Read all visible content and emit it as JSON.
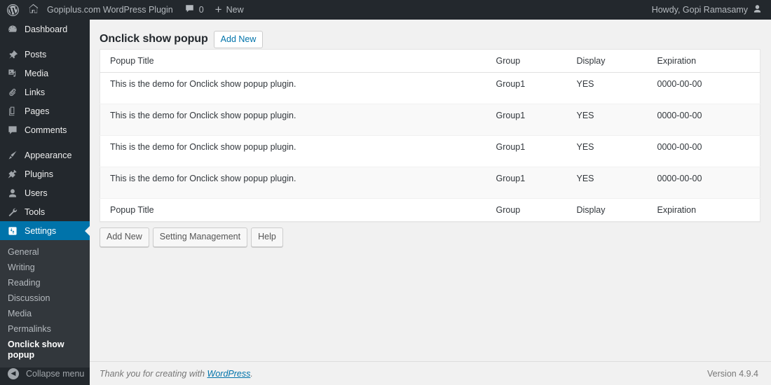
{
  "adminbar": {
    "logo_icon": "wordpress-logo-icon",
    "home_icon": "home-icon",
    "site_name": "Gopiplus.com WordPress Plugin",
    "comments_icon": "comment-bubble-icon",
    "comments_count": "0",
    "new_icon": "plus-icon",
    "new_label": "New",
    "howdy": "Howdy, Gopi Ramasamy",
    "avatar_icon": "user-avatar-icon"
  },
  "sidebar": {
    "items": [
      {
        "label": "Dashboard",
        "icon": "dashboard-icon",
        "current": false
      },
      {
        "label": "Posts",
        "icon": "pin-icon",
        "current": false
      },
      {
        "label": "Media",
        "icon": "media-icon",
        "current": false
      },
      {
        "label": "Links",
        "icon": "link-icon",
        "current": false
      },
      {
        "label": "Pages",
        "icon": "pages-icon",
        "current": false
      },
      {
        "label": "Comments",
        "icon": "comment-icon",
        "current": false
      },
      {
        "label": "Appearance",
        "icon": "appearance-brush-icon",
        "current": false
      },
      {
        "label": "Plugins",
        "icon": "plugin-icon",
        "current": false
      },
      {
        "label": "Users",
        "icon": "users-icon",
        "current": false
      },
      {
        "label": "Tools",
        "icon": "tools-wrench-icon",
        "current": false
      },
      {
        "label": "Settings",
        "icon": "settings-sliders-icon",
        "current": true
      }
    ],
    "submenu": [
      {
        "label": "General",
        "current": false
      },
      {
        "label": "Writing",
        "current": false
      },
      {
        "label": "Reading",
        "current": false
      },
      {
        "label": "Discussion",
        "current": false
      },
      {
        "label": "Media",
        "current": false
      },
      {
        "label": "Permalinks",
        "current": false
      },
      {
        "label": "Onclick show popup",
        "current": true
      }
    ],
    "collapse_label": "Collapse menu",
    "collapse_icon": "collapse-arrow-icon",
    "accent_color": "#0073aa",
    "background_color": "#23282d",
    "submenu_background_color": "#32373c"
  },
  "page": {
    "title": "Onclick show popup",
    "add_new_button": "Add New"
  },
  "table": {
    "columns": [
      "Popup Title",
      "Group",
      "Display",
      "Expiration"
    ],
    "rows": [
      {
        "title": "This is the demo for Onclick show popup plugin.",
        "group": "Group1",
        "display": "YES",
        "expiration": "0000-00-00"
      },
      {
        "title": "This is the demo for Onclick show popup plugin.",
        "group": "Group1",
        "display": "YES",
        "expiration": "0000-00-00"
      },
      {
        "title": "This is the demo for Onclick show popup plugin.",
        "group": "Group1",
        "display": "YES",
        "expiration": "0000-00-00"
      },
      {
        "title": "This is the demo for Onclick show popup plugin.",
        "group": "Group1",
        "display": "YES",
        "expiration": "0000-00-00"
      }
    ]
  },
  "actions": {
    "add_new": "Add New",
    "setting_management": "Setting Management",
    "help": "Help"
  },
  "footer": {
    "thanks_prefix": "Thank you for creating with ",
    "wordpress_link": "WordPress",
    "thanks_suffix": ".",
    "version": "Version 4.9.4"
  }
}
